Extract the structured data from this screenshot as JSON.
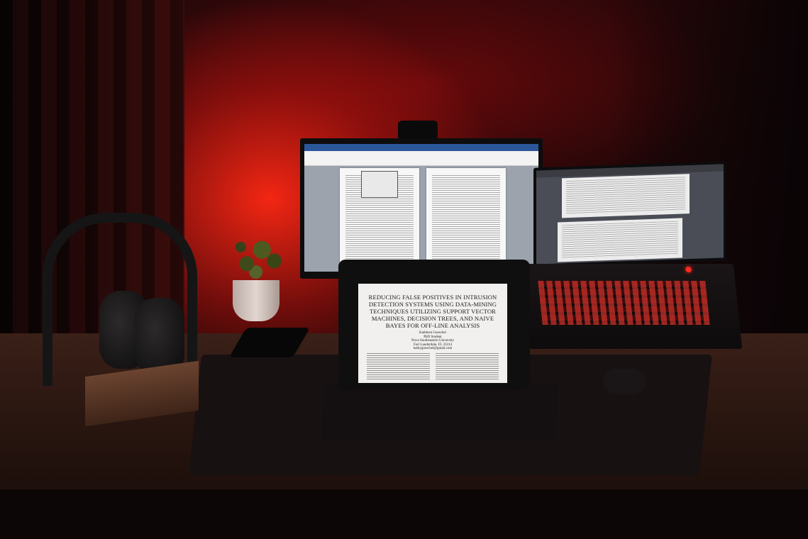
{
  "photo": {
    "tablet_document": {
      "title_lines": [
        "REDUCING FALSE POSITIVES IN INTRUSION",
        "DETECTION SYSTEMS USING DATA-MINING",
        "TECHNIQUES UTILIZING SUPPORT VECTOR",
        "MACHINES, DECISION TREES, AND NAIVE",
        "BAYES FOR OFF-LINE ANALYSIS"
      ],
      "author_lines": [
        "Kathleen Goeschel",
        "PhD Student",
        "Nova Southeastern University",
        "Fort Lauderdale, FL 33314",
        "kathygoeschel@gmail.com"
      ]
    },
    "colors": {
      "backlight": "#ff2814",
      "keyboard_backlight": "#ff3c32",
      "word_titlebar": "#2b579a"
    }
  }
}
